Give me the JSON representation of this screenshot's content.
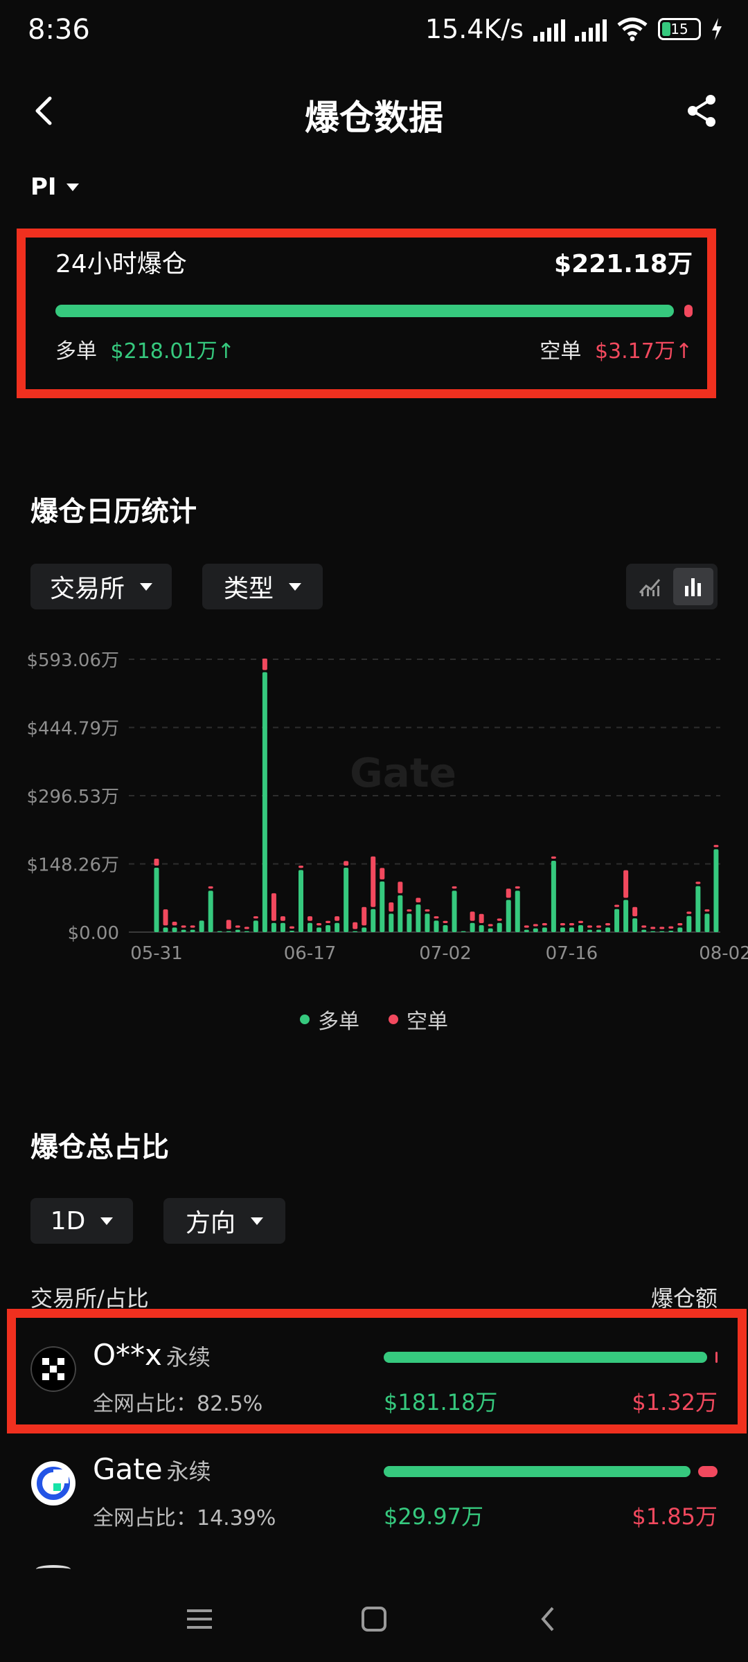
{
  "status_bar": {
    "time": "8:36",
    "net_speed": "15.4K/s",
    "battery": "15"
  },
  "header": {
    "title": "爆仓数据",
    "back_icon": "chevron-left-icon",
    "share_icon": "share-icon"
  },
  "pair": {
    "symbol": "PI"
  },
  "summary": {
    "label": "24小时爆仓",
    "total": "$221.18万",
    "long_label": "多单",
    "long_value": "$218.01万↑",
    "short_label": "空单",
    "short_value": "$3.17万↑",
    "long_fraction": 0.9857
  },
  "calendar": {
    "title": "爆仓日历统计",
    "exchange_dropdown": "交易所",
    "type_dropdown": "类型",
    "view_icons": [
      "line-chart-icon",
      "bar-chart-icon"
    ],
    "watermark": "Gate"
  },
  "chart_data": {
    "type": "bar",
    "stacked": true,
    "y_ticks": [
      "$593.06万",
      "$444.79万",
      "$296.53万",
      "$148.26万",
      "$0.00"
    ],
    "ylim": [
      0,
      593.06
    ],
    "y_unit": "万",
    "x_ticks": [
      "05-31",
      "06-17",
      "07-02",
      "07-16",
      "08-02"
    ],
    "grid": true,
    "legend_position": "bottom",
    "categories": [
      "05-31",
      "06-01",
      "06-02",
      "06-03",
      "06-04",
      "06-05",
      "06-06",
      "06-07",
      "06-08",
      "06-09",
      "06-10",
      "06-11",
      "06-12",
      "06-13",
      "06-14",
      "06-15",
      "06-16",
      "06-17",
      "06-18",
      "06-19",
      "06-20",
      "06-21",
      "06-22",
      "06-23",
      "06-24",
      "06-25",
      "06-26",
      "06-27",
      "06-28",
      "06-29",
      "06-30",
      "07-01",
      "07-02",
      "07-03",
      "07-04",
      "07-05",
      "07-06",
      "07-07",
      "07-08",
      "07-09",
      "07-10",
      "07-11",
      "07-12",
      "07-13",
      "07-14",
      "07-15",
      "07-16",
      "07-17",
      "07-18",
      "07-19",
      "07-20",
      "07-21",
      "07-22",
      "07-23",
      "07-24",
      "07-25",
      "07-26",
      "07-27",
      "07-28",
      "07-29",
      "07-30",
      "07-31",
      "08-01",
      "08-02"
    ],
    "series": [
      {
        "name": "多单",
        "color": "#36c97e",
        "values": [
          140,
          10,
          10,
          5,
          5,
          25,
          90,
          2,
          2,
          5,
          2,
          25,
          565,
          20,
          20,
          3,
          135,
          20,
          10,
          15,
          20,
          140,
          2,
          10,
          50,
          110,
          40,
          80,
          40,
          60,
          40,
          25,
          15,
          90,
          2,
          20,
          15,
          8,
          20,
          70,
          90,
          5,
          8,
          10,
          155,
          10,
          10,
          15,
          5,
          5,
          10,
          50,
          70,
          30,
          5,
          2,
          2,
          3,
          10,
          35,
          100,
          40,
          180,
          0
        ]
      },
      {
        "name": "空单",
        "color": "#f2495e",
        "values": [
          15,
          35,
          8,
          5,
          5,
          0,
          5,
          0,
          20,
          5,
          5,
          5,
          25,
          60,
          10,
          5,
          5,
          10,
          5,
          5,
          10,
          10,
          15,
          40,
          110,
          25,
          20,
          25,
          5,
          10,
          5,
          5,
          5,
          5,
          0,
          20,
          20,
          5,
          5,
          20,
          5,
          5,
          5,
          5,
          5,
          5,
          5,
          5,
          5,
          5,
          5,
          5,
          60,
          20,
          5,
          5,
          5,
          5,
          5,
          5,
          5,
          5,
          5,
          0
        ]
      }
    ]
  },
  "legend": {
    "long": "多单",
    "short": "空单"
  },
  "distribution": {
    "title": "爆仓总占比",
    "period_dropdown": "1D",
    "direction_dropdown": "方向",
    "col_left": "交易所/占比",
    "col_right": "爆仓额",
    "rows": [
      {
        "name": "O**x",
        "tag": "永续",
        "share": "全网占比：82.5%",
        "long": "$181.18万",
        "short": "$1.32万",
        "long_fraction": 0.988,
        "icon": "okx-logo-icon"
      },
      {
        "name": "Gate",
        "tag": "永续",
        "share": "全网占比：14.39%",
        "long": "$29.97万",
        "short": "$1.85万",
        "long_fraction": 0.94,
        "icon": "gate-logo-icon"
      }
    ]
  },
  "nav": {
    "icons": [
      "menu-icon",
      "home-icon",
      "back-icon"
    ]
  }
}
